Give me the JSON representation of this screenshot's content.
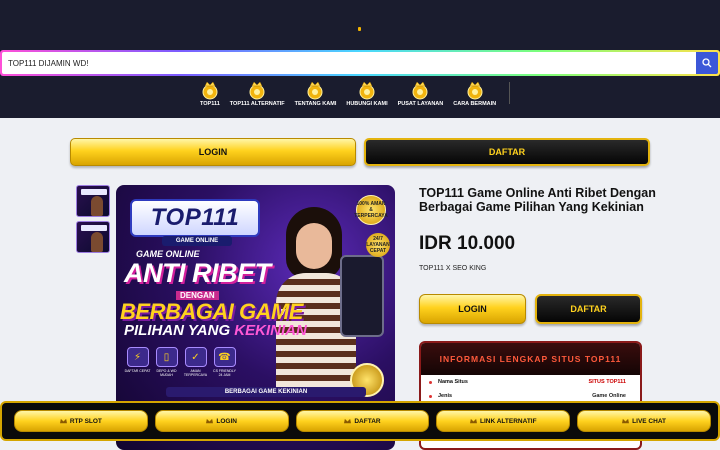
{
  "header": {
    "search": {
      "value": "TOP111 DIJAMIN WD!",
      "placeholder": ""
    },
    "nav": [
      {
        "label": "TOP111",
        "icon": "crown-icon"
      },
      {
        "label": "TOP111 ALTERNATIF",
        "icon": "crown-icon"
      },
      {
        "label": "TENTANG KAMI",
        "icon": "crown-icon"
      },
      {
        "label": "HUBUNGI KAMI",
        "icon": "crown-icon"
      },
      {
        "label": "PUSAT LAYANAN",
        "icon": "crown-icon"
      },
      {
        "label": "CARA BERMAIN",
        "icon": "crown-icon"
      }
    ]
  },
  "top_buttons": {
    "login": "LOGIN",
    "daftar": "DAFTAR"
  },
  "banner": {
    "logo": "TOP111",
    "sublogo": "GAME ONLINE",
    "badge": "100% AMAN & TERPERCAYA",
    "badge2": "24/7 LAYANAN CEPAT",
    "line1": "GAME ONLINE",
    "line2": "ANTI RIBET",
    "line3": "DENGAN",
    "line4": "BERBAGAI GAME",
    "line5a": "PILIHAN YANG ",
    "line5b": "KEKINIAN",
    "features": [
      {
        "label": "DAFTAR CEPAT",
        "glyph": "⚡"
      },
      {
        "label": "DEPO & WD MUDAH",
        "glyph": "▯"
      },
      {
        "label": "AMAN TERPERCAYA",
        "glyph": "✓"
      },
      {
        "label": "CS FRIENDLY 24 JAM",
        "glyph": "☎"
      }
    ],
    "footer": "BERBAGAI GAME KEKINIAN"
  },
  "product": {
    "title": "TOP111 Game Online Anti Ribet Dengan Berbagai Game Pilihan Yang Kekinian",
    "price": "IDR 10.000",
    "seller": "TOP111 X SEO KING",
    "login": "LOGIN",
    "daftar": "DAFTAR"
  },
  "info": {
    "heading": "INFORMASI LENGKAP SITUS TOP111",
    "rows": [
      {
        "key": "Nama Situs",
        "value": "SITUS TOP111"
      },
      {
        "key": "Jenis",
        "value": "Game Online"
      }
    ]
  },
  "bottom_bar": [
    {
      "label": "RTP SLOT"
    },
    {
      "label": "LOGIN"
    },
    {
      "label": "DAFTAR"
    },
    {
      "label": "LINK ALTERNATIF"
    },
    {
      "label": "LIVE CHAT"
    }
  ],
  "colors": {
    "header_bg": "#1a1c2e",
    "gold": "#ffd21e",
    "search_button": "#3c57d8",
    "info_heading": "#ff5a3c"
  }
}
